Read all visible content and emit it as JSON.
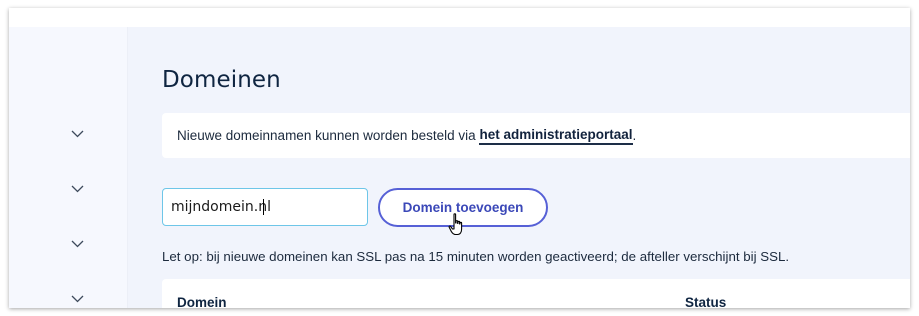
{
  "page": {
    "title": "Domeinen",
    "notice": {
      "text": "Nieuwe domeinnamen kunnen worden besteld via ",
      "link": "het administratieportaal",
      "suffix": "."
    },
    "domain_input": {
      "value": "mijndomein.nl"
    },
    "add_button_label": "Domein toevoegen",
    "warning": "Let op: bij nieuwe domeinen kan SSL pas na 15 minuten worden geactiveerd; de afteller verschijnt bij SSL.",
    "table": {
      "columns": [
        "Domein",
        "Status"
      ]
    }
  },
  "sidebar": {
    "toggles": [
      "chevron-down-icon",
      "chevron-down-icon",
      "chevron-down-icon",
      "chevron-down-icon"
    ]
  },
  "colors": {
    "title": "#0f2541",
    "sidebar_bg": "#f6f8fe",
    "main_bg": "#f1f4fc",
    "button_border": "#5660d6",
    "button_text": "#3b48b8",
    "input_border": "#6ec6e8"
  }
}
